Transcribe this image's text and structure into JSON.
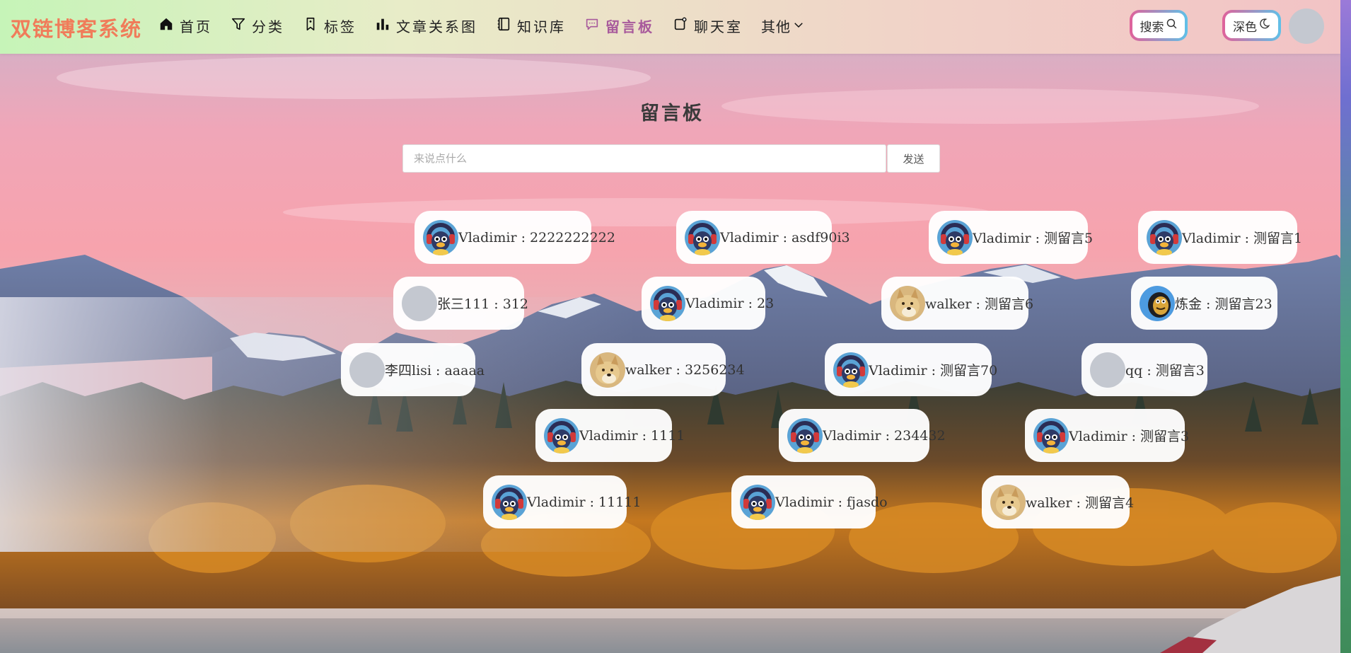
{
  "brand": "双链博客系统",
  "nav": [
    {
      "label": "首页",
      "icon": "home-icon",
      "active": false
    },
    {
      "label": "分类",
      "icon": "filter-icon",
      "active": false
    },
    {
      "label": "标签",
      "icon": "tag-icon",
      "active": false
    },
    {
      "label": "文章关系图",
      "icon": "bar-chart-icon",
      "active": false
    },
    {
      "label": "知识库",
      "icon": "notebook-icon",
      "active": false
    },
    {
      "label": "留言板",
      "icon": "message-icon",
      "active": true
    },
    {
      "label": "聊天室",
      "icon": "chat-icon",
      "active": false
    }
  ],
  "nav_more": "其他",
  "search_label": "搜索",
  "theme_label": "深色",
  "page_title": "留言板",
  "input": {
    "placeholder": "来说点什么",
    "value": ""
  },
  "send_label": "发送",
  "colors": {
    "brand": "#f07c5a",
    "active_nav": "#a85a9c",
    "pill_border_start": "#e0619a",
    "pill_border_end": "#5fc1e8"
  },
  "messages": [
    {
      "text": "Vladimir : 2222222222",
      "avatar": "penguin-avatar"
    },
    {
      "text": "Vladimir : asdf90i3",
      "avatar": "penguin-avatar"
    },
    {
      "text": "Vladimir : 测留言5",
      "avatar": "penguin-avatar"
    },
    {
      "text": "Vladimir : 测留言1",
      "avatar": "penguin-avatar"
    },
    {
      "text": "张三111 : 312",
      "avatar": "default-avatar"
    },
    {
      "text": "Vladimir : 23",
      "avatar": "penguin-avatar"
    },
    {
      "text": "walker : 测留言6",
      "avatar": "doge-avatar"
    },
    {
      "text": "炼金 : 测留言23",
      "avatar": "bird-avatar"
    },
    {
      "text": "李四lisi : aaaaa",
      "avatar": "default-avatar"
    },
    {
      "text": "walker : 3256234",
      "avatar": "doge-avatar"
    },
    {
      "text": "Vladimir : 测留言70",
      "avatar": "penguin-avatar"
    },
    {
      "text": "qq : 测留言3",
      "avatar": "default-avatar"
    },
    {
      "text": "Vladimir : 1111",
      "avatar": "penguin-avatar"
    },
    {
      "text": "Vladimir : 234432",
      "avatar": "penguin-avatar"
    },
    {
      "text": "Vladimir : 测留言3",
      "avatar": "penguin-avatar"
    },
    {
      "text": "Vladimir : 11111",
      "avatar": "penguin-avatar"
    },
    {
      "text": "Vladimir : fjasdo",
      "avatar": "penguin-avatar"
    },
    {
      "text": "walker : 测留言4",
      "avatar": "doge-avatar"
    }
  ]
}
